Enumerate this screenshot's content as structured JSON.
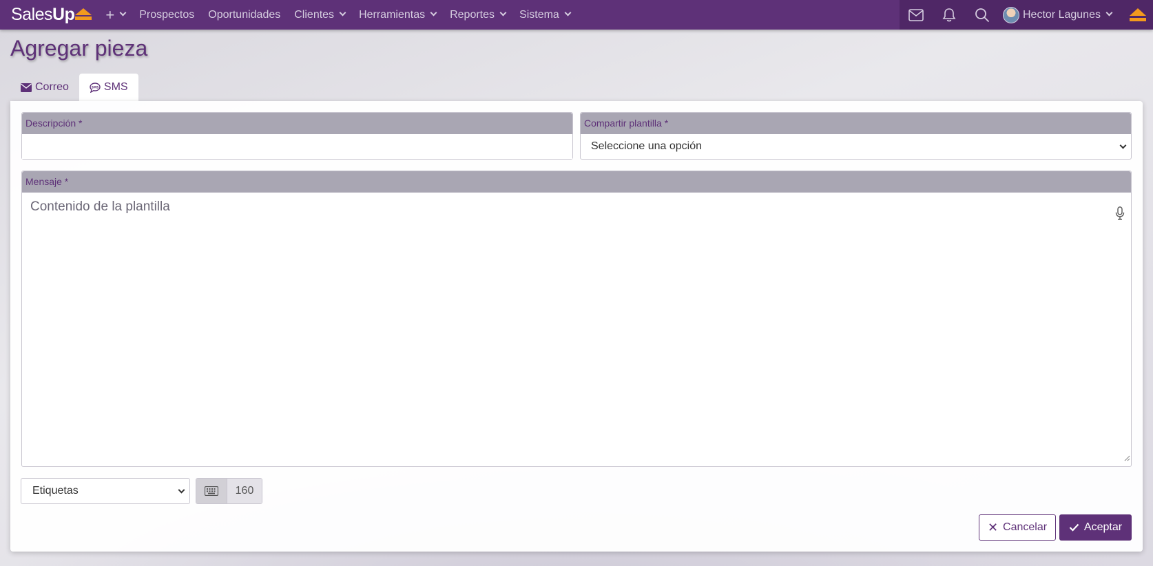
{
  "navbar": {
    "logo_sales": "Sales",
    "logo_up": "Up",
    "plus_icon": "+",
    "items": [
      {
        "label": "Prospectos"
      },
      {
        "label": "Oportunidades"
      },
      {
        "label": "Clientes"
      },
      {
        "label": "Herramientas"
      },
      {
        "label": "Reportes"
      },
      {
        "label": "Sistema"
      }
    ],
    "user_name": "Hector Lagunes"
  },
  "page": {
    "title": "Agregar pieza",
    "tabs": [
      {
        "label": "Correo",
        "icon": "envelope-icon"
      },
      {
        "label": "SMS",
        "icon": "sms-icon",
        "active": true
      }
    ]
  },
  "form": {
    "description_label": "Descripción *",
    "description_value": "",
    "share_label": "Compartir plantilla *",
    "share_selected": "Seleccione una opción",
    "message_label": "Mensaje *",
    "message_placeholder": "Contenido de la plantilla",
    "tags_selected": "Etiquetas",
    "char_count": "160"
  },
  "actions": {
    "cancel_label": "Cancelar",
    "accept_label": "Aceptar"
  },
  "colors": {
    "brand": "#5e3178",
    "brand_dark": "#4f2766",
    "accent": "#f39a1d",
    "label_bg": "#a9a6b3"
  }
}
